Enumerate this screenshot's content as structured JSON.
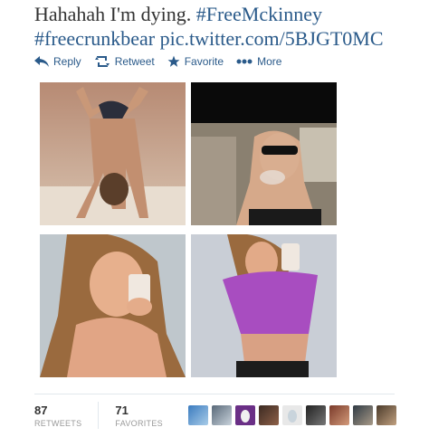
{
  "tweet": {
    "line1_text": "Hahahah I'm dying. ",
    "line1_hashtag": "#FreeMckinney",
    "line2_hashtag": "#freecrunkbear",
    "line2_link": "pic.twitter.com/5BJGT0MC"
  },
  "actions": [
    {
      "label": "Reply",
      "icon": "reply-icon"
    },
    {
      "label": "Retweet",
      "icon": "retweet-icon"
    },
    {
      "label": "Favorite",
      "icon": "star-icon"
    },
    {
      "label": "More",
      "icon": "more-icon"
    }
  ],
  "stats": {
    "retweets": {
      "count": "87",
      "label": "RETWEETS"
    },
    "favorites": {
      "count": "71",
      "label": "FAVORITES"
    }
  },
  "colors": {
    "link": "#2a5a8a",
    "text": "#333333",
    "muted": "#999999"
  }
}
